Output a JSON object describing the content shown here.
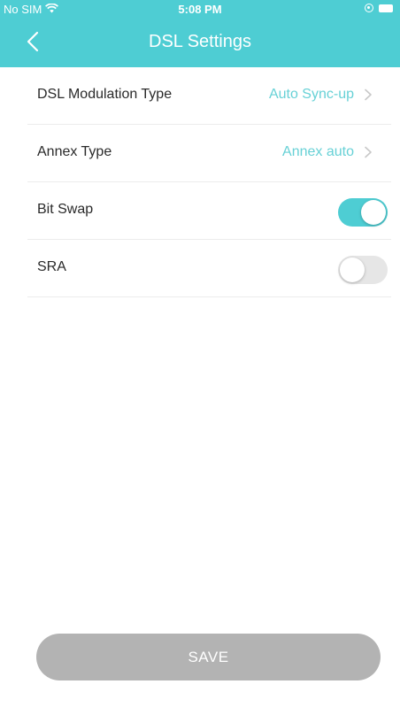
{
  "status_bar": {
    "carrier": "No SIM",
    "time": "5:08 PM",
    "icons": [
      "wifi-icon",
      "orientation-lock-icon",
      "battery-icon"
    ]
  },
  "header": {
    "title": "DSL Settings",
    "back_icon": "chevron-left-icon"
  },
  "settings": {
    "modulation": {
      "label": "DSL Modulation Type",
      "value": "Auto Sync-up"
    },
    "annex": {
      "label": "Annex Type",
      "value": "Annex auto"
    },
    "bitswap": {
      "label": "Bit Swap",
      "enabled": true
    },
    "sra": {
      "label": "SRA",
      "enabled": false
    }
  },
  "footer": {
    "save_label": "SAVE"
  },
  "colors": {
    "accent": "#4ecdd3",
    "value_text": "#67d1d6",
    "toggle_off": "#e6e6e6",
    "save_disabled": "#b3b3b3"
  }
}
